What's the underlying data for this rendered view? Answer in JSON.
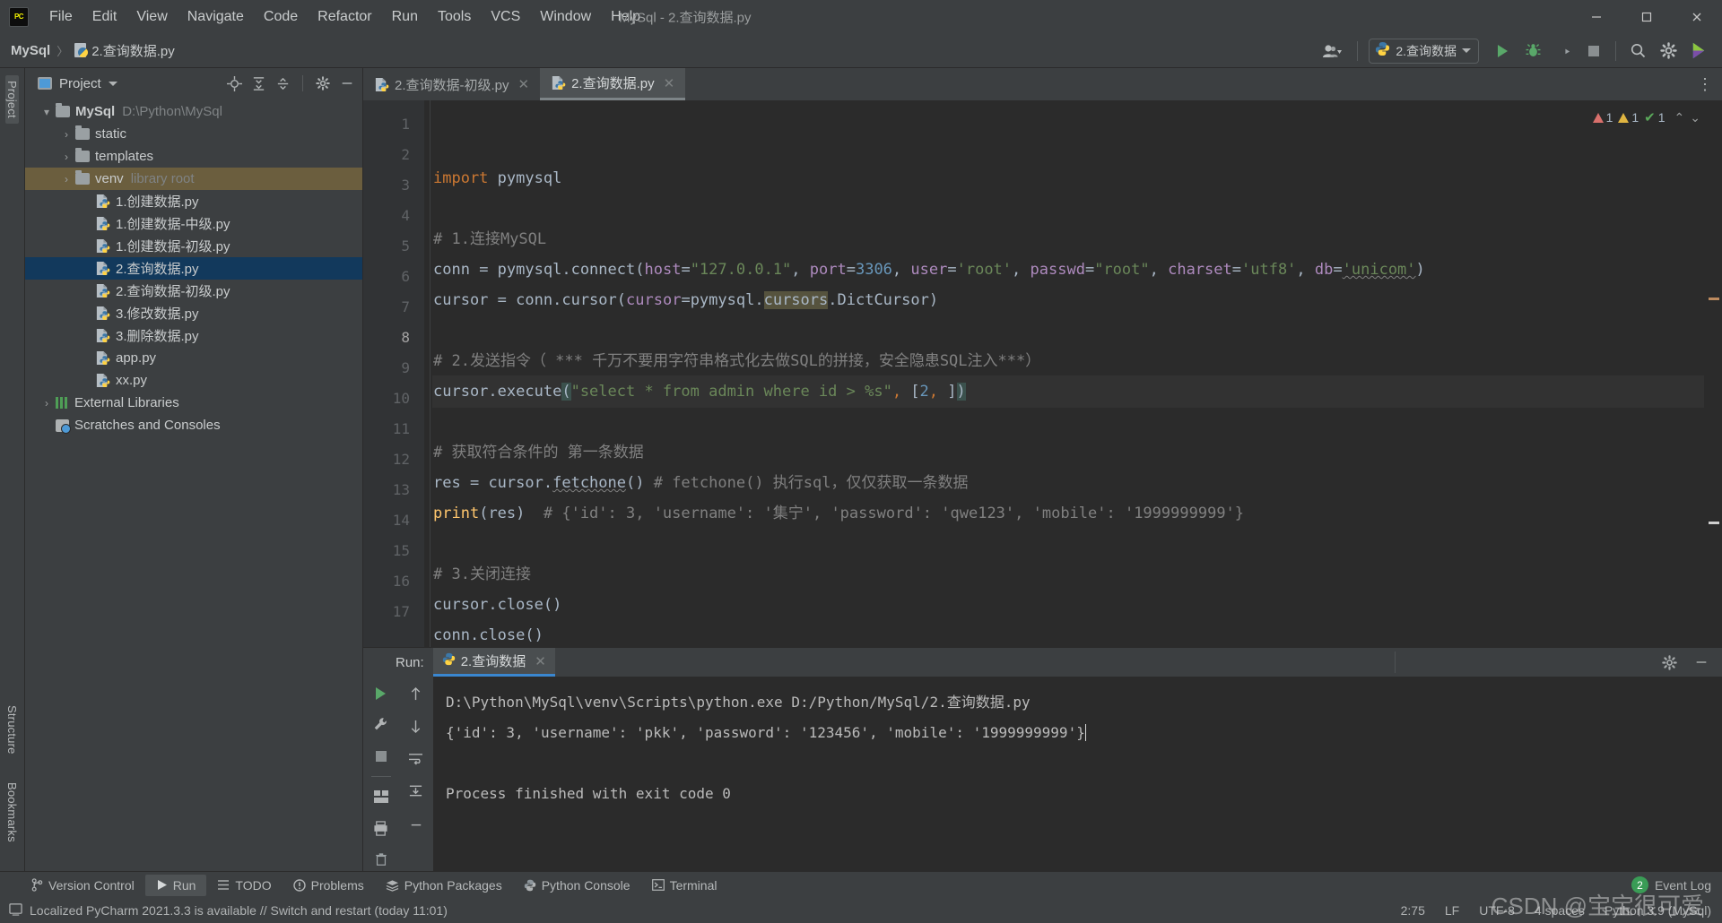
{
  "window": {
    "title": "MySql - 2.查询数据.py",
    "app_icon": "pycharm-logo-icon",
    "controls": {
      "minimize": "—",
      "maximize": "▢",
      "close": "✕"
    }
  },
  "menu": {
    "items": [
      "File",
      "Edit",
      "View",
      "Navigate",
      "Code",
      "Refactor",
      "Run",
      "Tools",
      "VCS",
      "Window",
      "Help"
    ]
  },
  "navbar": {
    "breadcrumbs": [
      "MySql",
      "2.查询数据.py"
    ],
    "separator": "〉",
    "run_config": {
      "label": "2.查询数据",
      "icon": "python-icon",
      "caret": "▾"
    },
    "buttons": [
      {
        "name": "account-icon",
        "glyph": "👤"
      },
      {
        "name": "run-icon",
        "glyph": "▶"
      },
      {
        "name": "debug-icon",
        "glyph": "🐞"
      },
      {
        "name": "run-with-coverage-icon",
        "glyph": "◑"
      },
      {
        "name": "stop-icon",
        "glyph": "■"
      },
      {
        "name": "search-everywhere-icon",
        "glyph": "🔍"
      },
      {
        "name": "settings-icon",
        "glyph": "⚙"
      },
      {
        "name": "updates-icon",
        "glyph": "◗"
      }
    ]
  },
  "left_strip": {
    "labels": [
      "Project",
      "Structure",
      "Bookmarks"
    ]
  },
  "project": {
    "title": "Project",
    "caret": "▾",
    "header_icons": [
      "locate-icon",
      "expand-all-icon",
      "collapse-all-icon",
      "settings-icon",
      "hide-icon"
    ],
    "tree": [
      {
        "indent": 0,
        "arrow": "▾",
        "icon": "folder",
        "name": "MySql",
        "bold": true,
        "note": "D:\\Python\\MySql",
        "state": "normal"
      },
      {
        "indent": 1,
        "arrow": "›",
        "icon": "folder",
        "name": "static",
        "bold": false,
        "note": "",
        "state": "normal"
      },
      {
        "indent": 1,
        "arrow": "›",
        "icon": "folder",
        "name": "templates",
        "bold": false,
        "note": "",
        "state": "normal"
      },
      {
        "indent": 1,
        "arrow": "›",
        "icon": "folder",
        "name": "venv",
        "bold": false,
        "note": "library root",
        "state": "highlight"
      },
      {
        "indent": 2,
        "arrow": "",
        "icon": "python-file",
        "name": "1.创建数据.py",
        "bold": false,
        "note": "",
        "state": "normal"
      },
      {
        "indent": 2,
        "arrow": "",
        "icon": "python-file",
        "name": "1.创建数据-中级.py",
        "bold": false,
        "note": "",
        "state": "normal"
      },
      {
        "indent": 2,
        "arrow": "",
        "icon": "python-file",
        "name": "1.创建数据-初级.py",
        "bold": false,
        "note": "",
        "state": "normal"
      },
      {
        "indent": 2,
        "arrow": "",
        "icon": "python-file",
        "name": "2.查询数据.py",
        "bold": false,
        "note": "",
        "state": "selected"
      },
      {
        "indent": 2,
        "arrow": "",
        "icon": "python-file",
        "name": "2.查询数据-初级.py",
        "bold": false,
        "note": "",
        "state": "normal"
      },
      {
        "indent": 2,
        "arrow": "",
        "icon": "python-file",
        "name": "3.修改数据.py",
        "bold": false,
        "note": "",
        "state": "normal"
      },
      {
        "indent": 2,
        "arrow": "",
        "icon": "python-file",
        "name": "3.删除数据.py",
        "bold": false,
        "note": "",
        "state": "normal"
      },
      {
        "indent": 2,
        "arrow": "",
        "icon": "python-file",
        "name": "app.py",
        "bold": false,
        "note": "",
        "state": "normal"
      },
      {
        "indent": 2,
        "arrow": "",
        "icon": "python-file",
        "name": "xx.py",
        "bold": false,
        "note": "",
        "state": "normal"
      },
      {
        "indent": 0,
        "arrow": "›",
        "icon": "libraries",
        "name": "External Libraries",
        "bold": false,
        "note": "",
        "state": "normal"
      },
      {
        "indent": 0,
        "arrow": "",
        "icon": "scratches",
        "name": "Scratches and Consoles",
        "bold": false,
        "note": "",
        "state": "normal"
      }
    ]
  },
  "editor": {
    "tabs": [
      {
        "label": "2.查询数据-初级.py",
        "active": false,
        "close": "✕"
      },
      {
        "label": "2.查询数据.py",
        "active": true,
        "close": "✕"
      }
    ],
    "line_numbers": [
      "1",
      "2",
      "3",
      "4",
      "5",
      "6",
      "7",
      "8",
      "9",
      "10",
      "11",
      "12",
      "13",
      "14",
      "15",
      "16",
      "17"
    ],
    "current_line": 8,
    "inspection": {
      "errors": "1",
      "warnings": "1",
      "checks": "1",
      "up": "⌃",
      "down": "⌄"
    },
    "lines": [
      {
        "n": 1,
        "text": "import pymysql"
      },
      {
        "n": 2,
        "text": ""
      },
      {
        "n": 3,
        "text": "# 1.连接MySQL"
      },
      {
        "n": 4,
        "text": "conn = pymysql.connect(host=\"127.0.0.1\", port=3306, user='root', passwd=\"root\", charset='utf8', db='unicom')"
      },
      {
        "n": 5,
        "text": "cursor = conn.cursor(cursor=pymysql.cursors.DictCursor)"
      },
      {
        "n": 6,
        "text": ""
      },
      {
        "n": 7,
        "text": "# 2.发送指令（ *** 千万不要用字符串格式化去做SQL的拼接，安全隐患SQL注入***）"
      },
      {
        "n": 8,
        "text": "cursor.execute(\"select * from admin where id > %s\", [2, ])"
      },
      {
        "n": 9,
        "text": ""
      },
      {
        "n": 10,
        "text": "# 获取符合条件的 第一条数据"
      },
      {
        "n": 11,
        "text": "res = cursor.fetchone() # fetchone() 执行sql，仅仅获取一条数据"
      },
      {
        "n": 12,
        "text": "print(res)  # {'id': 3, 'username': '集宁', 'password': 'qwe123', 'mobile': '1999999999'}"
      },
      {
        "n": 13,
        "text": ""
      },
      {
        "n": 14,
        "text": "# 3.关闭连接"
      },
      {
        "n": 15,
        "text": "cursor.close()"
      },
      {
        "n": 16,
        "text": "conn.close()"
      },
      {
        "n": 17,
        "text": ""
      }
    ]
  },
  "run_panel": {
    "label": "Run:",
    "tab": {
      "label": "2.查询数据",
      "icon": "python-icon",
      "close": "✕"
    },
    "side_buttons": [
      {
        "name": "rerun-icon",
        "glyph": "▶"
      },
      {
        "name": "wrench-icon",
        "glyph": "🔧"
      },
      {
        "name": "stop-icon",
        "glyph": "■"
      },
      {
        "name": "trash-icon",
        "glyph": "🗑"
      },
      {
        "name": "scroll-up-icon",
        "glyph": "↑"
      },
      {
        "name": "scroll-down-icon",
        "glyph": "↓"
      },
      {
        "name": "soft-wrap-icon",
        "glyph": "⇥"
      },
      {
        "name": "scroll-to-end-icon",
        "glyph": "↧"
      },
      {
        "name": "print-icon",
        "glyph": "🖨"
      },
      {
        "name": "pin-icon",
        "glyph": "📌"
      }
    ],
    "header_icons": [
      {
        "name": "settings-icon",
        "glyph": "⚙"
      },
      {
        "name": "hide-icon",
        "glyph": "—"
      }
    ],
    "console_lines": [
      "D:\\Python\\MySql\\venv\\Scripts\\python.exe D:/Python/MySql/2.查询数据.py",
      "{'id': 3, 'username': 'pkk', 'password': '123456', 'mobile': '1999999999'}",
      "",
      "Process finished with exit code 0"
    ]
  },
  "bottom_tools": [
    {
      "label": "Version Control",
      "icon": "branch-icon",
      "active": false
    },
    {
      "label": "Run",
      "icon": "play-icon",
      "active": true
    },
    {
      "label": "TODO",
      "icon": "list-icon",
      "active": false
    },
    {
      "label": "Problems",
      "icon": "exclamation-icon",
      "active": false
    },
    {
      "label": "Python Packages",
      "icon": "packages-icon",
      "active": false
    },
    {
      "label": "Python Console",
      "icon": "python-icon",
      "active": false
    },
    {
      "label": "Terminal",
      "icon": "terminal-icon",
      "active": false
    }
  ],
  "status_bar": {
    "message": "Localized PyCharm 2021.3.3 is available // Switch and restart (today 11:01)",
    "message_icon": "ide-update-icon",
    "caret_position": "2:75",
    "line_separator": "LF",
    "encoding": "UTF-8",
    "indent": "4 spaces",
    "interpreter": "Python 3.9 (MySql)",
    "event_log": {
      "label": "Event Log",
      "count": "2"
    }
  },
  "watermark": "CSDN @宝宝很可爱",
  "colors": {
    "bg": "#3c3f41",
    "editor_bg": "#2b2b2b",
    "gutter": "#313335",
    "selection": "#12395c",
    "accent_blue": "#3a87d0",
    "green": "#59a869",
    "keyword": "#cc7832",
    "string": "#6a8759",
    "number": "#6897bb",
    "comment": "#808080",
    "function": "#ffc66d"
  }
}
